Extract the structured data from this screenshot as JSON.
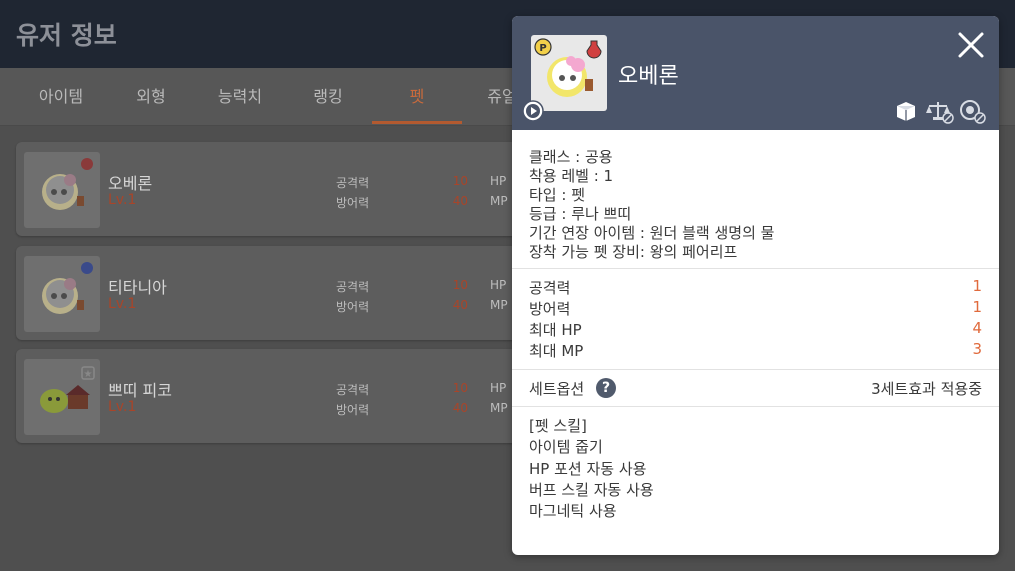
{
  "header": {
    "title": "유저 정보"
  },
  "tabs": [
    {
      "label": "아이템"
    },
    {
      "label": "외형"
    },
    {
      "label": "능력치"
    },
    {
      "label": "랭킹"
    },
    {
      "label": "펫"
    },
    {
      "label": "쥬얼"
    }
  ],
  "pets": [
    {
      "name": "오베론",
      "level": "Lv.1",
      "stat1_label": "공격력",
      "stat1_value": "10",
      "stat1_key": "HP",
      "stat2_label": "방어력",
      "stat2_value": "40",
      "stat2_key": "MP"
    },
    {
      "name": "티타니아",
      "level": "Lv.1",
      "stat1_label": "공격력",
      "stat1_value": "10",
      "stat1_key": "HP",
      "stat2_label": "방어력",
      "stat2_value": "40",
      "stat2_key": "MP"
    },
    {
      "name": "쁘띠 피코",
      "level": "Lv.1",
      "stat1_label": "공격력",
      "stat1_value": "10",
      "stat1_key": "HP",
      "stat2_label": "방어력",
      "stat2_value": "40",
      "stat2_key": "MP"
    }
  ],
  "popup": {
    "name": "오베론",
    "info": [
      "클래스 : 공용",
      "착용 레벨 : 1",
      "타입 : 펫",
      "등급 : 루나 쁘띠",
      "기간 연장 아이템 : 원더 블랙 생명의 물",
      "장착 가능 펫 장비: 왕의 페어리프"
    ],
    "stats": [
      {
        "label": "공격력",
        "value": "1"
      },
      {
        "label": "방어력",
        "value": "1"
      },
      {
        "label": "최대 HP",
        "value": "4"
      },
      {
        "label": "최대 MP",
        "value": "3"
      }
    ],
    "set_option": {
      "label": "세트옵션",
      "help": "?",
      "status": "3세트효과 적용중"
    },
    "skills": [
      "[펫 스킬]",
      "아이템 줍기",
      "HP 포션 자동 사용",
      "버프 스킬 자동 사용",
      "마그네틱 사용"
    ]
  },
  "colors": {
    "accent": "#e06a3c",
    "header": "#4a5469",
    "tab_active": "#c96a3c"
  },
  "icons": [
    "close-icon",
    "play-icon",
    "potion-icon",
    "p-badge-icon",
    "box-icon",
    "scale-icon",
    "gear-lock-icon",
    "help-icon"
  ]
}
